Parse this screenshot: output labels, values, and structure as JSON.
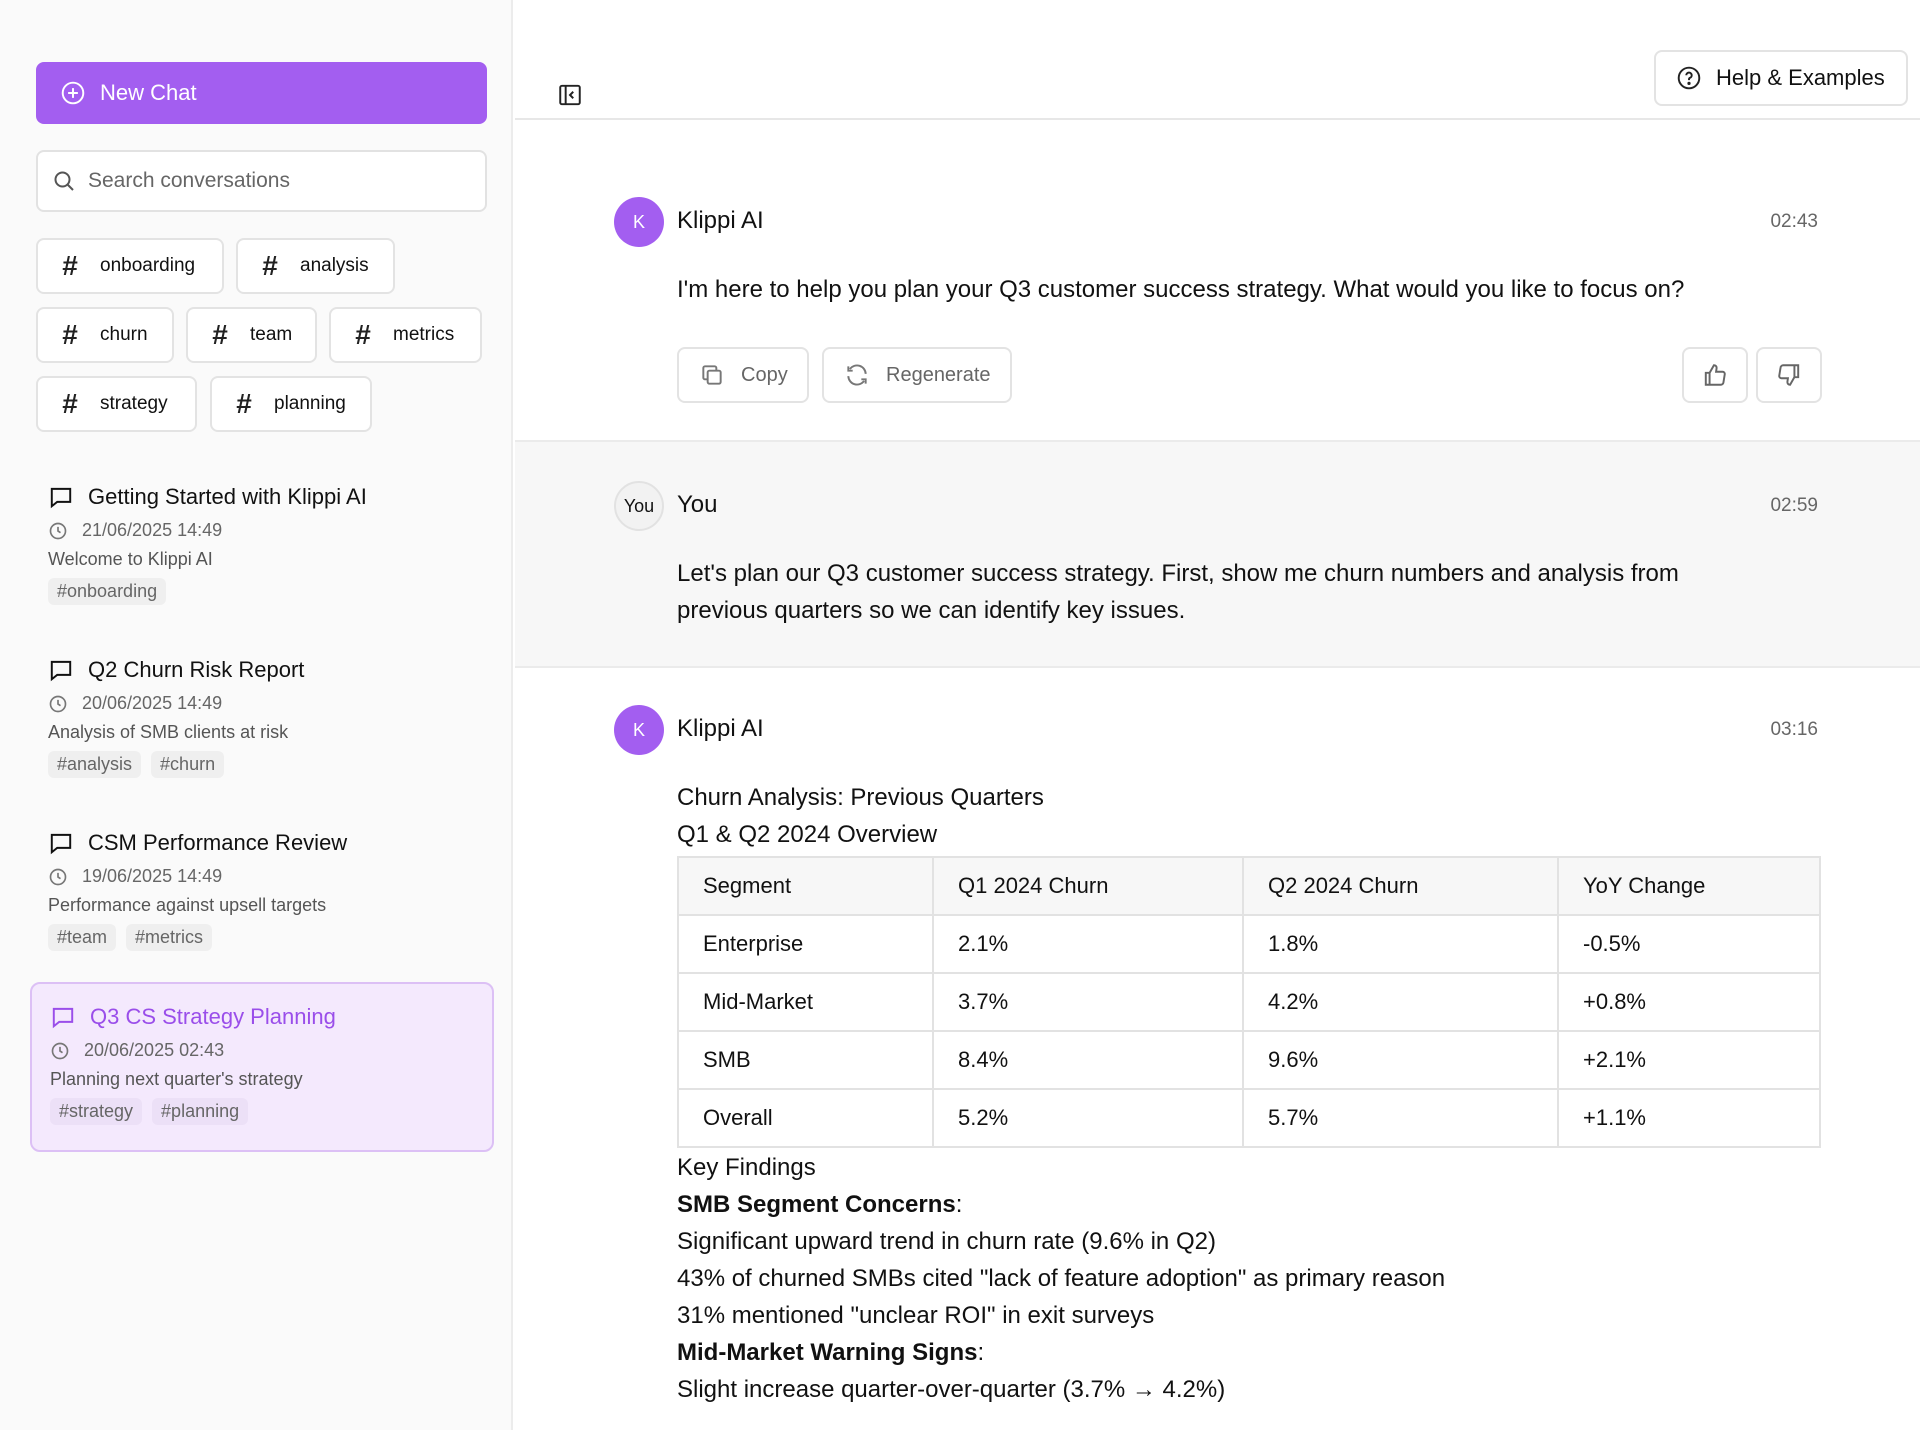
{
  "sidebar": {
    "new_chat_label": "New Chat",
    "search_placeholder": "Search conversations",
    "tags": [
      "onboarding",
      "analysis",
      "churn",
      "team",
      "metrics",
      "strategy",
      "planning"
    ],
    "conversations": [
      {
        "title": "Getting Started with Klippi AI",
        "date": "21/06/2025 14:49",
        "desc": "Welcome to Klippi AI",
        "tags": [
          "#onboarding"
        ]
      },
      {
        "title": "Q2 Churn Risk Report",
        "date": "20/06/2025 14:49",
        "desc": "Analysis of SMB clients at risk",
        "tags": [
          "#analysis",
          "#churn"
        ]
      },
      {
        "title": "CSM Performance Review",
        "date": "19/06/2025 14:49",
        "desc": "Performance against upsell targets",
        "tags": [
          "#team",
          "#metrics"
        ]
      },
      {
        "title": "Q3 CS Strategy Planning",
        "date": "20/06/2025 02:43",
        "desc": "Planning next quarter's strategy",
        "tags": [
          "#strategy",
          "#planning"
        ]
      }
    ]
  },
  "header": {
    "help_label": "Help & Examples"
  },
  "messages": {
    "m1": {
      "avatar": "K",
      "sender": "Klippi AI",
      "time": "02:43",
      "text": "I'm here to help you plan your Q3 customer success strategy. What would you like to focus on?",
      "copy_label": "Copy",
      "regenerate_label": "Regenerate"
    },
    "m2": {
      "avatar": "You",
      "sender": "You",
      "time": "02:59",
      "text_line1": "Let's plan our Q3 customer success strategy. First, show me churn numbers and analysis from",
      "text_line2": "previous quarters so we can identify key issues."
    },
    "m3": {
      "avatar": "K",
      "sender": "Klippi AI",
      "time": "03:16",
      "heading1": "Churn Analysis: Previous Quarters",
      "heading2": "Q1 & Q2 2024 Overview",
      "table": {
        "headers": [
          "Segment",
          "Q1 2024 Churn",
          "Q2 2024 Churn",
          "YoY Change"
        ],
        "rows": [
          [
            "Enterprise",
            "2.1%",
            "1.8%",
            "-0.5%"
          ],
          [
            "Mid-Market",
            "3.7%",
            "4.2%",
            "+0.8%"
          ],
          [
            "SMB",
            "8.4%",
            "9.6%",
            "+2.1%"
          ],
          [
            "Overall",
            "5.2%",
            "5.7%",
            "+1.1%"
          ]
        ]
      },
      "findings_title": "Key Findings",
      "smb_title": "SMB Segment Concerns",
      "smb_points": [
        "Significant upward trend in churn rate (9.6% in Q2)",
        "43% of churned SMBs cited \"lack of feature adoption\" as primary reason",
        "31% mentioned \"unclear ROI\" in exit surveys"
      ],
      "mid_title": "Mid-Market Warning Signs",
      "mid_points": [
        "Slight increase quarter-over-quarter (3.7% → 4.2%)"
      ]
    }
  },
  "colors": {
    "accent": "#a35ef0",
    "active_bg": "#f4e9fd"
  }
}
